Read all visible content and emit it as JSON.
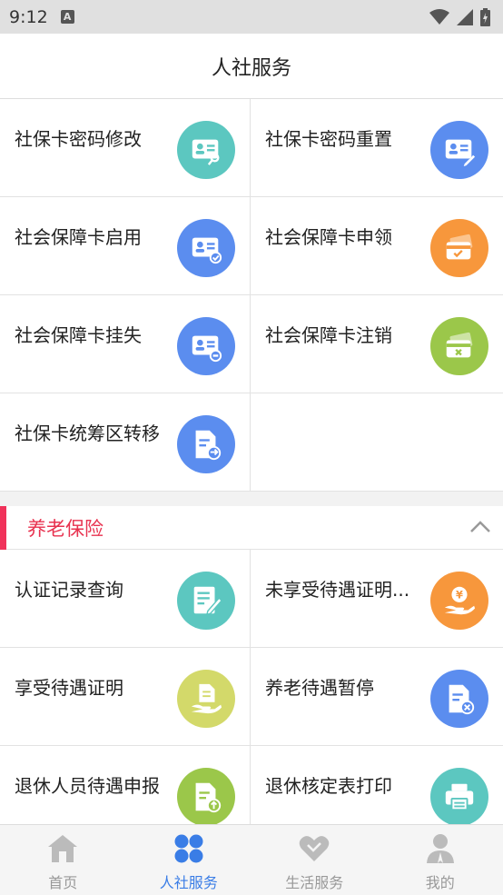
{
  "status_bar": {
    "time": "9:12",
    "notification_icon": "A"
  },
  "header": {
    "title": "人社服务"
  },
  "card_services": [
    {
      "label": "社保卡密码修改",
      "icon": "id-card-key-icon",
      "color": "#5cc7c0"
    },
    {
      "label": "社保卡密码重置",
      "icon": "id-card-edit-icon",
      "color": "#5b8def"
    },
    {
      "label": "社会保障卡启用",
      "icon": "id-card-check-icon",
      "color": "#5b8def"
    },
    {
      "label": "社会保障卡申领",
      "icon": "cards-apply-icon",
      "color": "#f7973c"
    },
    {
      "label": "社会保障卡挂失",
      "icon": "id-card-minus-icon",
      "color": "#5b8def"
    },
    {
      "label": "社会保障卡注销",
      "icon": "cards-cancel-icon",
      "color": "#9bc74a"
    },
    {
      "label": "社保卡统筹区转移",
      "icon": "document-transfer-icon",
      "color": "#5b8def"
    }
  ],
  "pension_section": {
    "title": "养老保险",
    "items": [
      {
        "label": "认证记录查询",
        "icon": "document-pen-icon",
        "color": "#5cc7c0"
      },
      {
        "label": "未享受待遇证明...",
        "icon": "money-hand-icon",
        "color": "#f7973c"
      },
      {
        "label": "享受待遇证明",
        "icon": "document-hand-icon",
        "color": "#d3d96a"
      },
      {
        "label": "养老待遇暂停",
        "icon": "document-cancel-icon",
        "color": "#5b8def"
      },
      {
        "label": "退休人员待遇申报",
        "icon": "document-upload-icon",
        "color": "#9bc74a"
      },
      {
        "label": "退休核定表打印",
        "icon": "printer-icon",
        "color": "#5cc7c0"
      }
    ]
  },
  "tabbar": {
    "tabs": [
      {
        "label": "首页",
        "icon": "home-icon",
        "active": false
      },
      {
        "label": "人社服务",
        "icon": "clover-icon",
        "active": true
      },
      {
        "label": "生活服务",
        "icon": "heart-icon",
        "active": false
      },
      {
        "label": "我的",
        "icon": "user-icon",
        "active": false
      }
    ],
    "active_color": "#3a7de6",
    "inactive_color": "#bbbbbb"
  }
}
